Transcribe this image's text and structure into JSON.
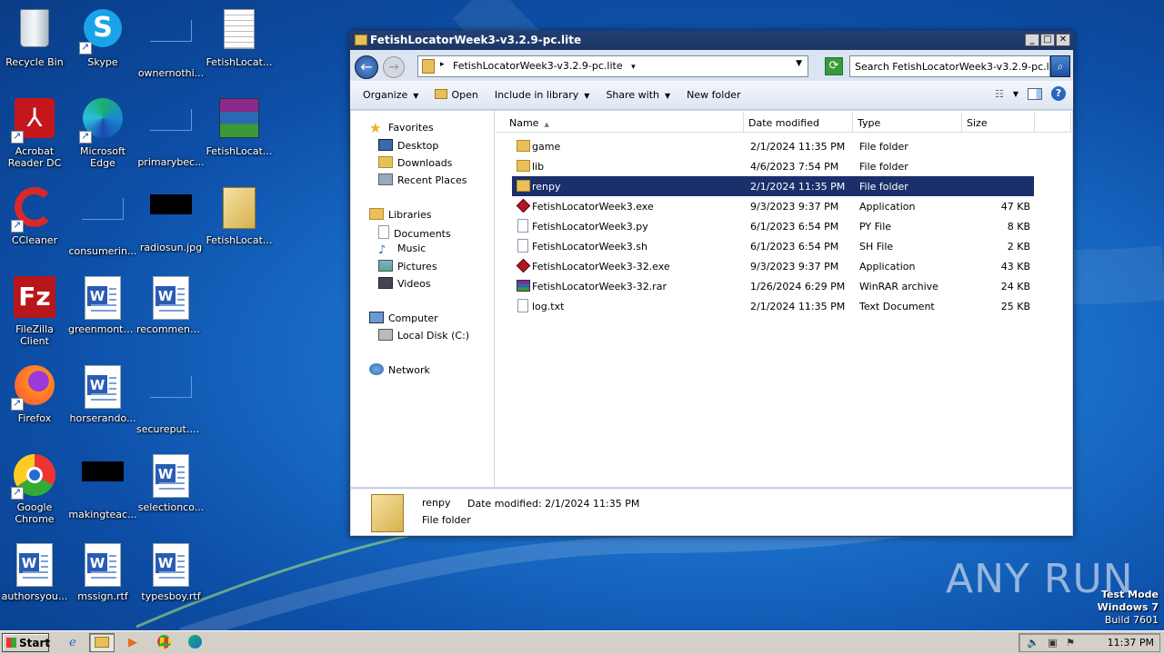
{
  "desktop": {
    "icons": [
      {
        "label": "Recycle Bin"
      },
      {
        "label": "Skype"
      },
      {
        "label": "ownernothi..."
      },
      {
        "label": "FetishLocat..."
      },
      {
        "label": "Acrobat Reader DC"
      },
      {
        "label": "Microsoft Edge"
      },
      {
        "label": "primarybec..."
      },
      {
        "label": "FetishLocat..."
      },
      {
        "label": "CCleaner"
      },
      {
        "label": "consumerin..."
      },
      {
        "label": "radiosun.jpg"
      },
      {
        "label": "FetishLocat..."
      },
      {
        "label": "FileZilla Client"
      },
      {
        "label": "greenmonth..."
      },
      {
        "label": "recommend..."
      },
      {
        "label": "Firefox"
      },
      {
        "label": "horserando..."
      },
      {
        "label": "secureput.png"
      },
      {
        "label": "Google Chrome"
      },
      {
        "label": "makingteac..."
      },
      {
        "label": "selectionco..."
      },
      {
        "label": "authorsyou..."
      },
      {
        "label": "mssign.rtf"
      },
      {
        "label": "typesboy.rtf"
      }
    ]
  },
  "window": {
    "title": "FetishLocatorWeek3-v3.2.9-pc.lite",
    "address": "FetishLocatorWeek3-v3.2.9-pc.lite",
    "search_placeholder": "Search FetishLocatorWeek3-v3.2.9-pc.lite",
    "toolbar": {
      "organize": "Organize",
      "open": "Open",
      "include": "Include in library",
      "share": "Share with",
      "new_folder": "New folder"
    },
    "nav": {
      "favorites": "Favorites",
      "desktop": "Desktop",
      "downloads": "Downloads",
      "recent": "Recent Places",
      "libraries": "Libraries",
      "documents": "Documents",
      "music": "Music",
      "pictures": "Pictures",
      "videos": "Videos",
      "computer": "Computer",
      "localdisk": "Local Disk (C:)",
      "network": "Network"
    },
    "columns": {
      "name": "Name",
      "date": "Date modified",
      "type": "Type",
      "size": "Size"
    },
    "files": [
      {
        "name": "game",
        "date": "2/1/2024 11:35 PM",
        "type": "File folder",
        "size": "",
        "icon": "folder-icon"
      },
      {
        "name": "lib",
        "date": "4/6/2023 7:54 PM",
        "type": "File folder",
        "size": "",
        "icon": "folder-icon"
      },
      {
        "name": "renpy",
        "date": "2/1/2024 11:35 PM",
        "type": "File folder",
        "size": "",
        "icon": "folder-icon"
      },
      {
        "name": "FetishLocatorWeek3.exe",
        "date": "9/3/2023 9:37 PM",
        "type": "Application",
        "size": "47 KB",
        "icon": "exe-icon"
      },
      {
        "name": "FetishLocatorWeek3.py",
        "date": "6/1/2023 6:54 PM",
        "type": "PY File",
        "size": "8 KB",
        "icon": "document-icon"
      },
      {
        "name": "FetishLocatorWeek3.sh",
        "date": "6/1/2023 6:54 PM",
        "type": "SH File",
        "size": "2 KB",
        "icon": "document-icon"
      },
      {
        "name": "FetishLocatorWeek3-32.exe",
        "date": "9/3/2023 9:37 PM",
        "type": "Application",
        "size": "43 KB",
        "icon": "exe-icon"
      },
      {
        "name": "FetishLocatorWeek3-32.rar",
        "date": "1/26/2024 6:29 PM",
        "type": "WinRAR archive",
        "size": "24 KB",
        "icon": "rar-icon"
      },
      {
        "name": "log.txt",
        "date": "2/1/2024 11:35 PM",
        "type": "Text Document",
        "size": "25 KB",
        "icon": "document-icon"
      }
    ],
    "selected_index": 2,
    "details": {
      "name": "renpy",
      "date_label": "Date modified: 2/1/2024 11:35 PM",
      "type": "File folder"
    }
  },
  "taskbar": {
    "start": "Start",
    "clock": "11:37 PM"
  },
  "watermark": "ANY RUN",
  "testmode": {
    "line1": "Test Mode",
    "line2": "Windows 7",
    "line3": "Build 7601"
  }
}
